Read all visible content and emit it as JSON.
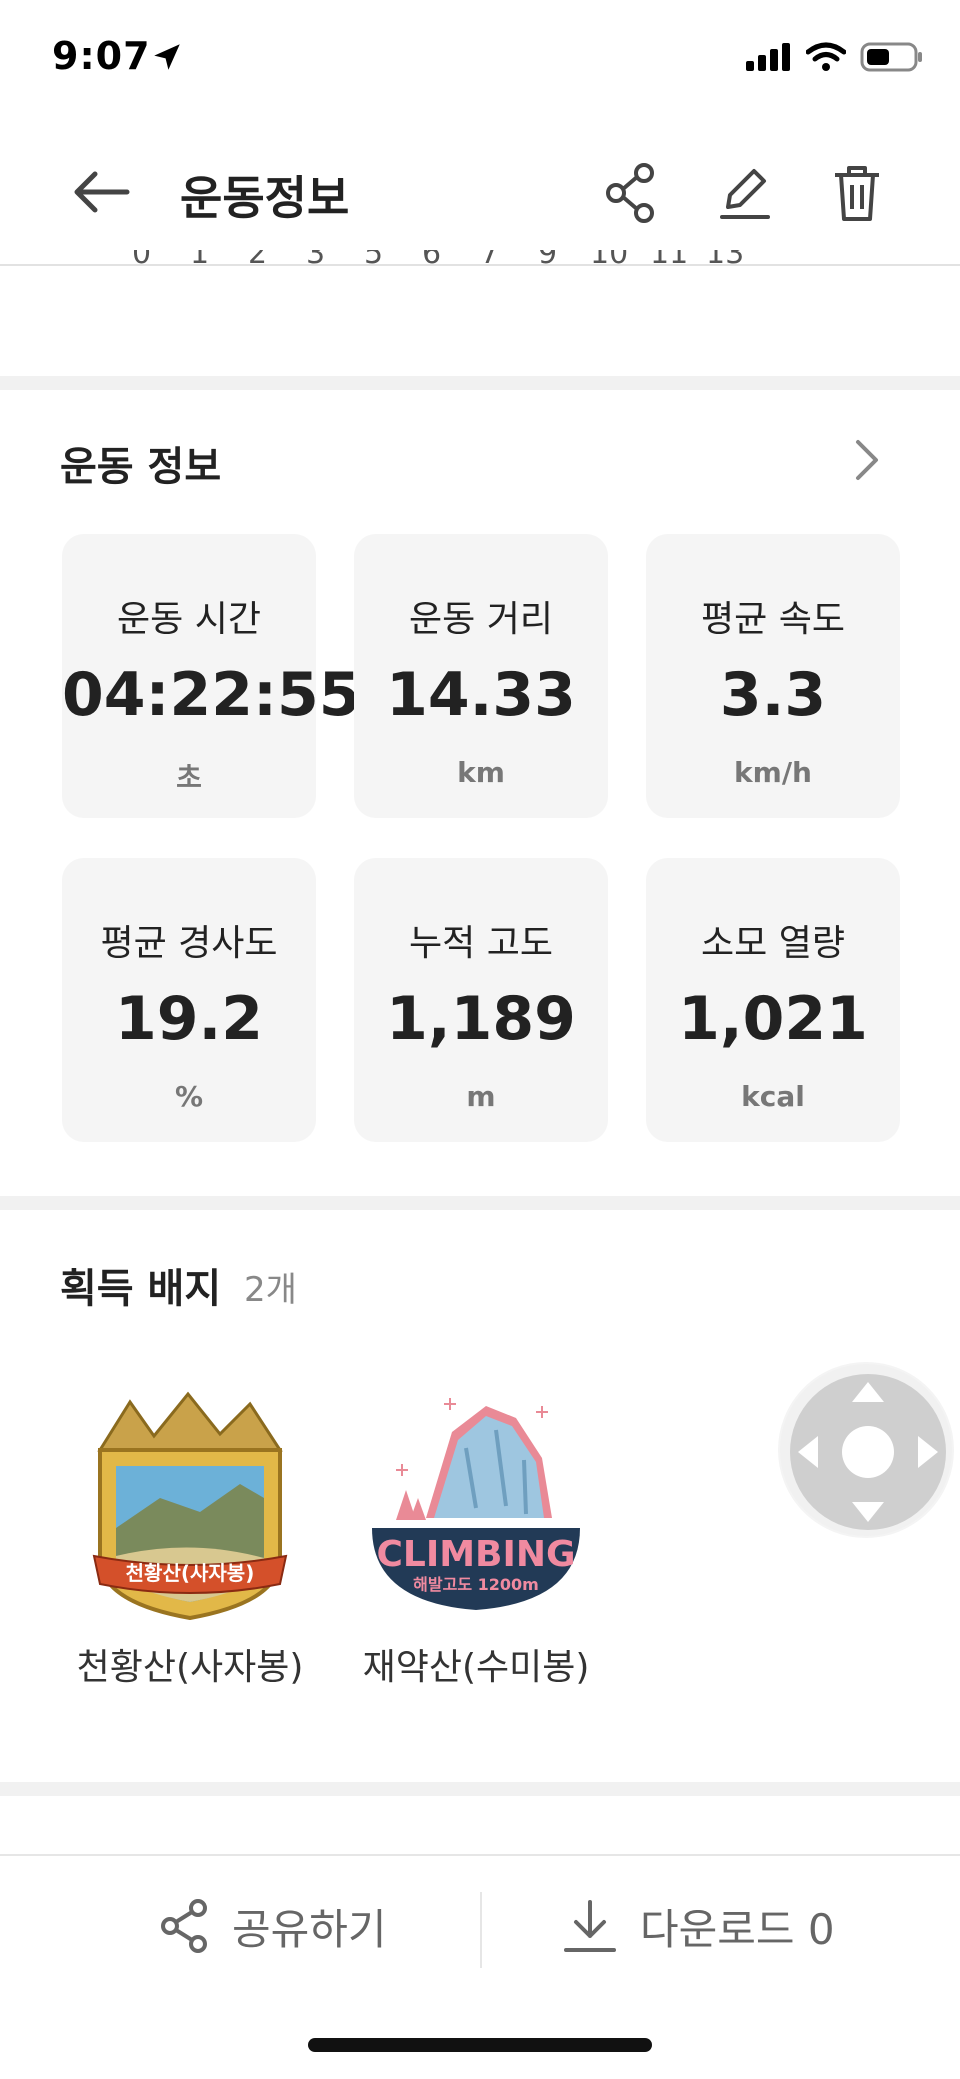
{
  "status_bar": {
    "time": "9:07"
  },
  "header": {
    "title": "운동정보"
  },
  "chart_axis": {
    "ticks": [
      "0",
      "1",
      "2",
      "3",
      "5",
      "6",
      "7",
      "9",
      "10",
      "11",
      "13"
    ]
  },
  "exercise_info": {
    "title": "운동 정보",
    "stats": [
      {
        "label": "운동 시간",
        "value": "04:22:55",
        "unit": "초"
      },
      {
        "label": "운동 거리",
        "value": "14.33",
        "unit": "km"
      },
      {
        "label": "평균 속도",
        "value": "3.3",
        "unit": "km/h"
      },
      {
        "label": "평균 경사도",
        "value": "19.2",
        "unit": "%"
      },
      {
        "label": "누적 고도",
        "value": "1,189",
        "unit": "m"
      },
      {
        "label": "소모 열량",
        "value": "1,021",
        "unit": "kcal"
      }
    ]
  },
  "badges": {
    "title": "획득 배지",
    "count": "2개",
    "items": [
      {
        "name": "천황산(사자봉)",
        "ribbon_text": "천황산(사자봉)"
      },
      {
        "name": "재약산(수미봉)",
        "logo_text": "CLIMBING",
        "logo_sub": "해발고도 1200m"
      }
    ]
  },
  "bottom_bar": {
    "share_label": "공유하기",
    "download_label": "다운로드 0"
  },
  "colors": {
    "card_bg": "#f5f5f5",
    "divider": "#f1f1f1",
    "text": "#222222",
    "muted": "#777777"
  }
}
